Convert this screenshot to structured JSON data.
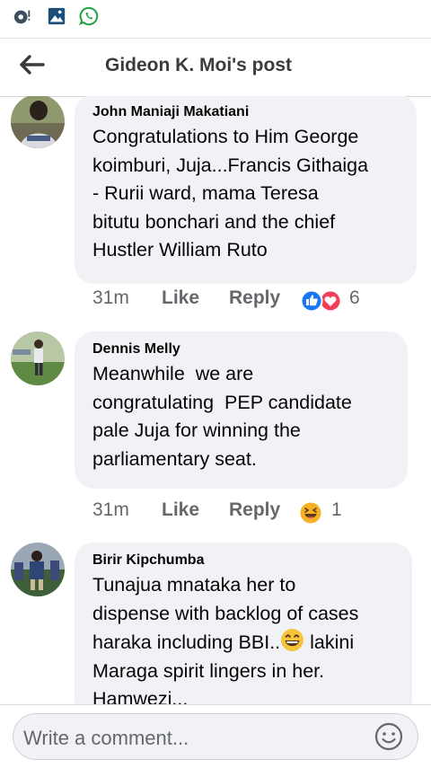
{
  "status_bar": {
    "icons": [
      "location-alert-icon",
      "gallery-icon",
      "whatsapp-icon"
    ]
  },
  "header": {
    "back_icon": "arrow-left-icon",
    "title": "Gideon K. Moi's post"
  },
  "comments": [
    {
      "author": "John Maniaji Makatiani",
      "lines": [
        "Congratulations to Him George",
        "koimburi, Juja...Francis Githaiga",
        "- Rurii ward, mama Teresa",
        "bitutu bonchari and the chief",
        "Hustler William Ruto"
      ],
      "time": "31m",
      "like_label": "Like",
      "reply_label": "Reply",
      "reactions": [
        "like-reaction-icon",
        "love-reaction-icon"
      ],
      "reaction_count": "6"
    },
    {
      "author": "Dennis Melly",
      "lines": [
        "Meanwhile  we are",
        "congratulating  PEP candidate",
        "pale Juja for winning the",
        "parliamentary seat."
      ],
      "time": "31m",
      "like_label": "Like",
      "reply_label": "Reply",
      "reactions": [
        "haha-reaction-icon"
      ],
      "reaction_count": "1"
    },
    {
      "author": "Birir Kipchumba",
      "lines": [
        "Tunajua mnataka her to",
        "dispense with backlog of cases",
        "haraka including BBI..",
        " lakini",
        "Maraga spirit lingers in her.",
        "Hamwezi..."
      ],
      "inline_emoji": "grinning-face-icon"
    }
  ],
  "composer": {
    "placeholder": "Write a comment...",
    "emoji_icon": "smiley-icon"
  },
  "colors": {
    "whatsapp_green": "#25a244",
    "icon_blue": "#1d4e7a",
    "like_blue": "#1877f2",
    "love_red": "#f33e58",
    "haha_yellow": "#f7b125"
  }
}
